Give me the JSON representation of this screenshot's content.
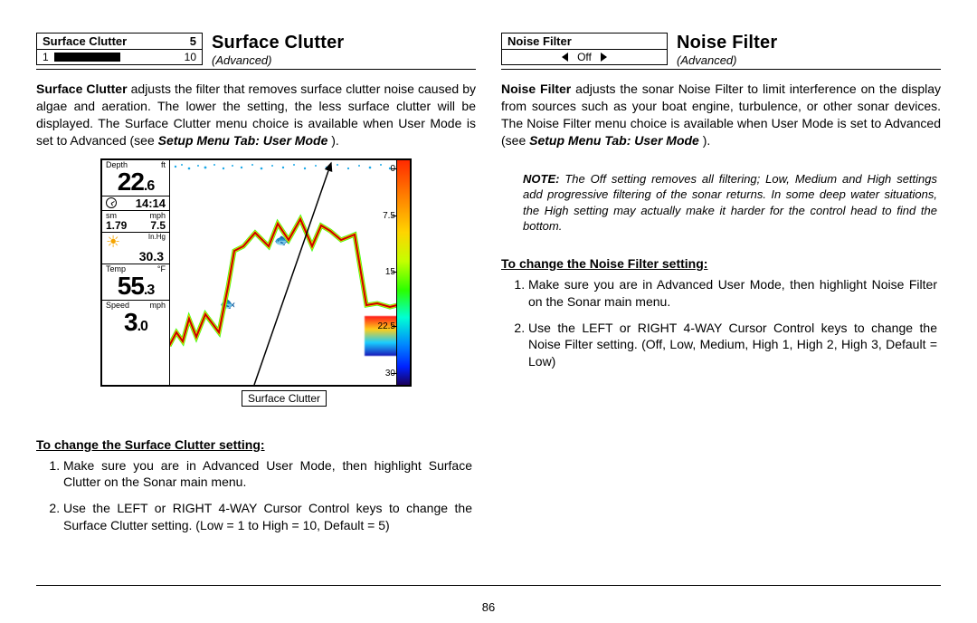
{
  "page_number": "86",
  "left": {
    "menu": {
      "title": "Surface Clutter",
      "value": "5",
      "min": "1",
      "max": "10"
    },
    "heading": {
      "title": "Surface Clutter",
      "subtitle": "(Advanced)"
    },
    "body_lead": "Surface Clutter",
    "body_rest": " adjusts the filter that removes surface clutter noise caused by algae and aeration. The lower the setting, the less surface clutter will be displayed. The Surface Clutter menu choice is available when User Mode is set to Advanced (see ",
    "body_ref": "Setup Menu Tab: User Mode",
    "body_end": " ).",
    "sonar": {
      "depth_label": "Depth",
      "depth_unit": "ft",
      "depth_val_int": "22",
      "depth_val_dec": ".6",
      "time": "14:14",
      "sm": "sm",
      "mph": "mph",
      "sm_val": "1.79",
      "mph_val": "7.5",
      "inhg": "In.Hg",
      "baro": "30.3",
      "temp_label": "Temp",
      "temp_unit": "°F",
      "temp_int": "55",
      "temp_dec": ".3",
      "speed_label": "Speed",
      "speed_unit": "mph",
      "speed_int": "3",
      "speed_dec": ".0",
      "ticks": {
        "t0": "0",
        "t1": "7.5",
        "t2": "15",
        "t3": "22.5",
        "t4": "30"
      },
      "caption": "Surface Clutter"
    },
    "change_head": "To change the Surface Clutter setting:",
    "steps": [
      "Make sure you are in Advanced User Mode, then highlight Surface Clutter on the Sonar main menu.",
      "Use the LEFT or RIGHT 4-WAY Cursor Control keys to change the Surface Clutter setting. (Low = 1 to High = 10, Default = 5)"
    ]
  },
  "right": {
    "menu": {
      "title": "Noise Filter",
      "value": "Off"
    },
    "heading": {
      "title": "Noise Filter",
      "subtitle": "(Advanced)"
    },
    "body_lead": "Noise Filter",
    "body_rest": " adjusts the sonar Noise Filter to limit interference on the display from sources such as your boat engine, turbulence, or other sonar devices. The Noise Filter menu choice is available when User Mode is set to Advanced (see ",
    "body_ref": "Setup Menu Tab: User Mode",
    "body_end": " ).",
    "note_label": "NOTE:",
    "note": " The Off setting removes all filtering; Low, Medium and High settings add progressive filtering of the sonar returns. In some deep water situations, the High setting may actually make it harder for the control head to find the bottom.",
    "change_head": "To change the Noise Filter setting:",
    "steps": [
      "Make sure you are in Advanced User Mode, then highlight Noise Filter on the Sonar main menu.",
      "Use the LEFT or RIGHT 4-WAY Cursor Control keys to change the Noise Filter setting. (Off, Low, Medium, High 1, High 2, High 3, Default = Low)"
    ]
  }
}
